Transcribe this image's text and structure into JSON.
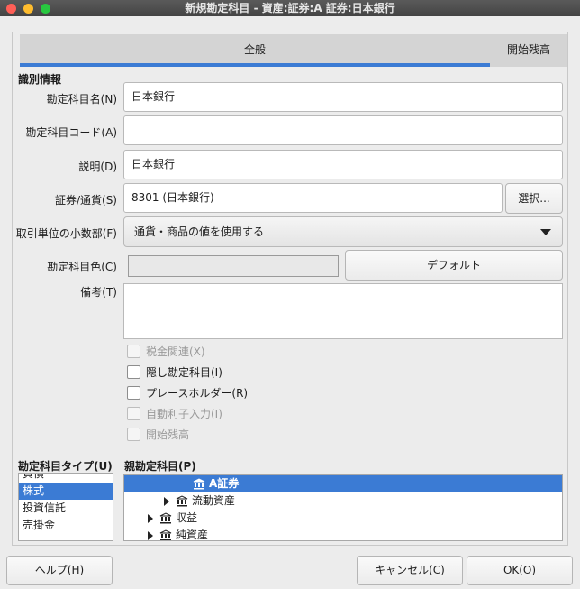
{
  "window": {
    "title": "新規勘定科目 - 資産:証券:A 証券:日本銀行"
  },
  "tabs": [
    {
      "label": "全般"
    },
    {
      "label": "開始残高"
    }
  ],
  "section": {
    "title": "識別情報"
  },
  "form": {
    "name": {
      "label": "勘定科目名(N)",
      "value": "日本銀行"
    },
    "code": {
      "label": "勘定科目コード(A)",
      "value": ""
    },
    "description": {
      "label": "説明(D)",
      "value": "日本銀行"
    },
    "security": {
      "label": "証券/通貨(S)",
      "value": "8301 (日本銀行)",
      "select_label": "選択..."
    },
    "fraction": {
      "label": "取引単位の小数部(F)",
      "value": "通貨・商品の値を使用する"
    },
    "color": {
      "label": "勘定科目色(C)",
      "default_label": "デフォルト"
    },
    "notes": {
      "label": "備考(T)",
      "value": ""
    }
  },
  "checkboxes": [
    {
      "label": "税金関連(X)",
      "checked": false,
      "disabled": true
    },
    {
      "label": "隠し勘定科目(I)",
      "checked": false,
      "disabled": false
    },
    {
      "label": "プレースホルダー(R)",
      "checked": false,
      "disabled": false
    },
    {
      "label": "自動利子入力(I)",
      "checked": false,
      "disabled": true
    },
    {
      "label": "開始残高",
      "checked": false,
      "disabled": true
    }
  ],
  "account_type": {
    "title": "勘定科目タイプ(U)",
    "items": [
      {
        "label": "負債"
      },
      {
        "label": "株式",
        "selected": true
      },
      {
        "label": "投資信託"
      },
      {
        "label": "売掛金"
      }
    ]
  },
  "parent_account": {
    "title": "親勘定科目(P)",
    "rows": [
      {
        "label": "A証券",
        "selected": true
      },
      {
        "label": "流動資産"
      },
      {
        "label": "収益"
      },
      {
        "label": "純資産"
      }
    ]
  },
  "buttons": {
    "help": "ヘルプ(H)",
    "cancel": "キャンセル(C)",
    "ok": "OK(O)"
  },
  "colors": {
    "accent": "#3b7bd4"
  }
}
